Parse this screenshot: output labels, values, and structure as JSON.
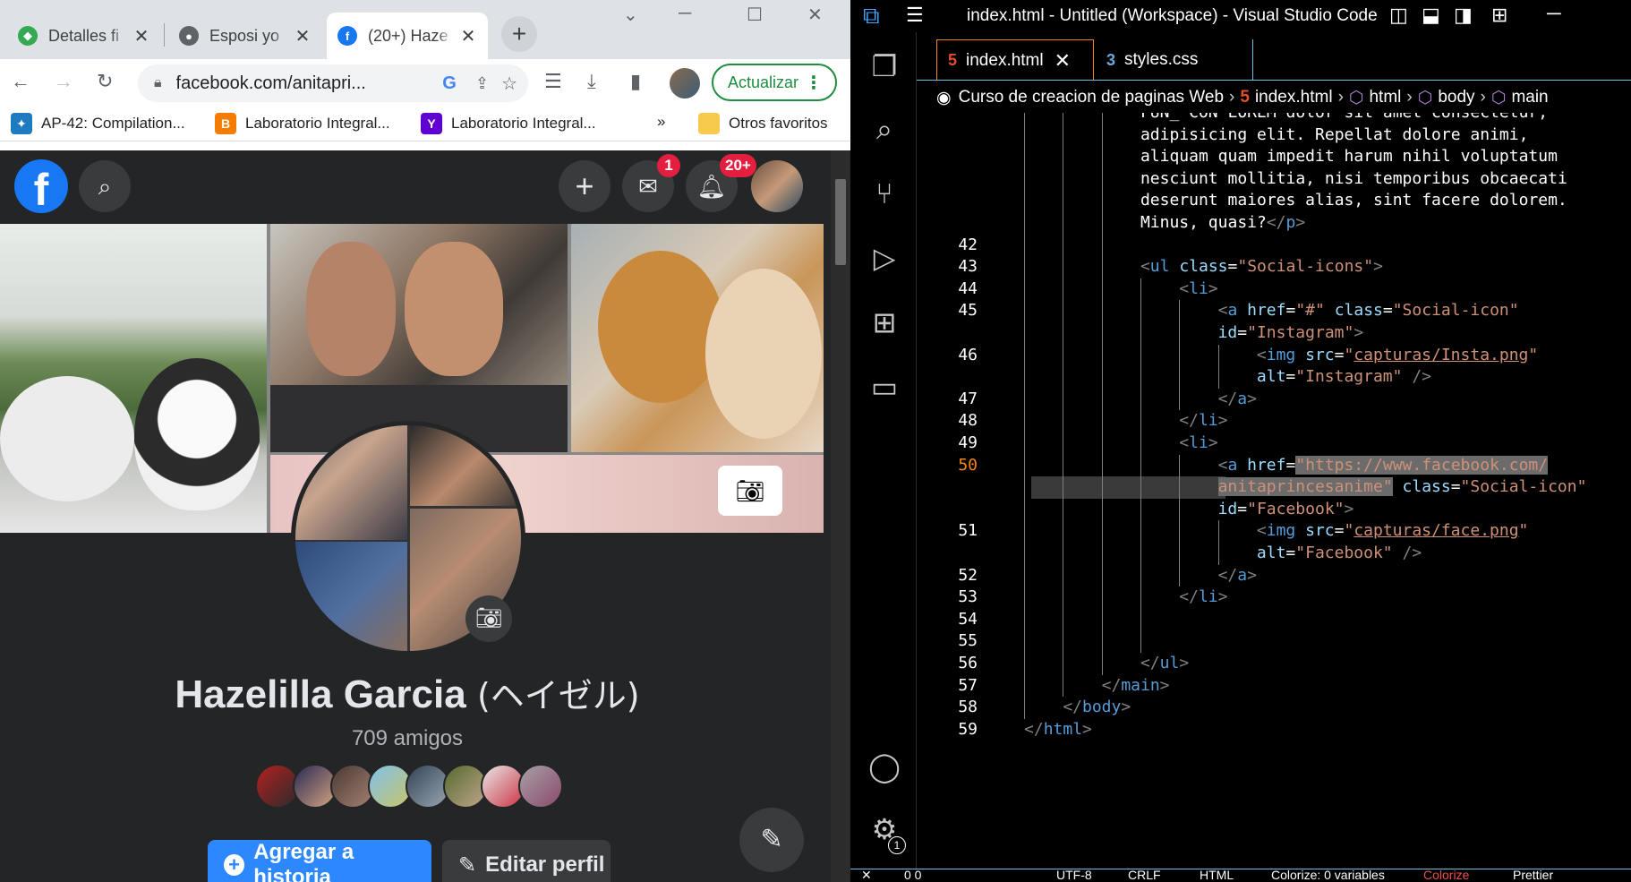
{
  "chrome": {
    "tabs": [
      {
        "title": "Detalles fi",
        "icon": "diamond-icon",
        "color": "#34a853"
      },
      {
        "title": "Esposi yo",
        "icon": "globe-icon",
        "color": "#5f6368"
      },
      {
        "title": "(20+) Haze",
        "icon": "facebook-icon",
        "color": "#1877f2"
      }
    ],
    "url": "facebook.com/anitapri...",
    "update_label": "Actualizar",
    "bookmarks": [
      {
        "label": "AP-42: Compilation...",
        "color": "#1f7bc1"
      },
      {
        "label": "Laboratorio Integral...",
        "color": "#f57c00"
      },
      {
        "label": "Laboratorio Integral...",
        "color": "#6001d2"
      },
      {
        "label": "»",
        "color": ""
      },
      {
        "label": "Otros favoritos",
        "color": "#f7ca4d"
      }
    ]
  },
  "facebook": {
    "messenger_badge": "1",
    "notif_badge": "20+",
    "name": "Hazelilla Garcia",
    "alt_name": "(ヘイゼル)",
    "friends": "709 amigos",
    "story_button": "Agregar a historia",
    "edit_button": "Editar perfil"
  },
  "vscode": {
    "title": "index.html - Untitled (Workspace) - Visual Studio Code",
    "tabs": [
      {
        "label": "index.html",
        "active": true
      },
      {
        "label": "styles.css",
        "active": false
      }
    ],
    "breadcrumbs": [
      "Curso de creacion de paginas Web",
      "index.html",
      "html",
      "body",
      "main"
    ],
    "settings_badge": "1",
    "status": {
      "encoding": "UTF-8",
      "eol": "CRLF",
      "lang": "HTML",
      "colorize": "Colorize: 0 variables",
      "colorize2": "Colorize",
      "prettier": "Prettier",
      "problems": "0  0"
    }
  },
  "code_lines": [
    {
      "num": "",
      "indent": 6,
      "parts": [
        [
          "t-txt",
          "FUN_ CON LOREM dolor sit amet consectetur,"
        ]
      ]
    },
    {
      "num": "",
      "indent": 6,
      "parts": [
        [
          "t-txt",
          "adipisicing elit. Repellat dolore animi,"
        ]
      ]
    },
    {
      "num": "",
      "indent": 6,
      "parts": [
        [
          "t-txt",
          "aliquam quam impedit harum nihil voluptatum"
        ]
      ]
    },
    {
      "num": "",
      "indent": 6,
      "parts": [
        [
          "t-txt",
          "nesciunt mollitia, nisi temporibus obcaecati"
        ]
      ]
    },
    {
      "num": "",
      "indent": 6,
      "parts": [
        [
          "t-txt",
          "deserunt maiores alias, sint facere dolorem."
        ]
      ]
    },
    {
      "num": "",
      "indent": 6,
      "parts": [
        [
          "t-txt",
          "Minus, quasi?"
        ],
        [
          "t-br",
          "</"
        ],
        [
          "t-tag",
          "p"
        ],
        [
          "t-br",
          ">"
        ]
      ]
    },
    {
      "num": "42",
      "indent": 6,
      "parts": []
    },
    {
      "num": "43",
      "indent": 6,
      "parts": [
        [
          "t-br",
          "<"
        ],
        [
          "t-tag",
          "ul"
        ],
        [
          "t-txt",
          " "
        ],
        [
          "t-attr",
          "class"
        ],
        [
          "t-txt",
          "="
        ],
        [
          "t-str",
          "\"Social-icons\""
        ],
        [
          "t-br",
          ">"
        ]
      ]
    },
    {
      "num": "44",
      "indent": 8,
      "parts": [
        [
          "t-br",
          "<"
        ],
        [
          "t-tag",
          "li"
        ],
        [
          "t-br",
          ">"
        ]
      ]
    },
    {
      "num": "45",
      "indent": 10,
      "parts": [
        [
          "t-br",
          "<"
        ],
        [
          "t-tag",
          "a"
        ],
        [
          "t-txt",
          " "
        ],
        [
          "t-attr",
          "href"
        ],
        [
          "t-txt",
          "="
        ],
        [
          "t-str",
          "\"#\""
        ],
        [
          "t-txt",
          " "
        ],
        [
          "t-attr",
          "class"
        ],
        [
          "t-txt",
          "="
        ],
        [
          "t-str",
          "\"Social-icon\""
        ]
      ]
    },
    {
      "num": "",
      "indent": 10,
      "parts": [
        [
          "t-attr",
          "id"
        ],
        [
          "t-txt",
          "="
        ],
        [
          "t-str",
          "\"Instagram\""
        ],
        [
          "t-br",
          ">"
        ]
      ]
    },
    {
      "num": "46",
      "indent": 12,
      "parts": [
        [
          "t-br",
          "<"
        ],
        [
          "t-tag",
          "img"
        ],
        [
          "t-txt",
          " "
        ],
        [
          "t-attr",
          "src"
        ],
        [
          "t-txt",
          "="
        ],
        [
          "t-str",
          "\""
        ],
        [
          "t-str u",
          "capturas/Insta.png"
        ],
        [
          "t-str",
          "\""
        ]
      ]
    },
    {
      "num": "",
      "indent": 12,
      "parts": [
        [
          "t-attr",
          "alt"
        ],
        [
          "t-txt",
          "="
        ],
        [
          "t-str",
          "\"Instagram\""
        ],
        [
          "t-txt",
          " "
        ],
        [
          "t-br",
          "/>"
        ]
      ]
    },
    {
      "num": "47",
      "indent": 10,
      "parts": [
        [
          "t-br",
          "</"
        ],
        [
          "t-tag",
          "a"
        ],
        [
          "t-br",
          ">"
        ]
      ]
    },
    {
      "num": "48",
      "indent": 8,
      "parts": [
        [
          "t-br",
          "</"
        ],
        [
          "t-tag",
          "li"
        ],
        [
          "t-br",
          ">"
        ]
      ]
    },
    {
      "num": "49",
      "indent": 8,
      "parts": [
        [
          "t-br",
          "<"
        ],
        [
          "t-tag",
          "li"
        ],
        [
          "t-br",
          ">"
        ]
      ]
    },
    {
      "num": "50",
      "indent": 10,
      "cur": true,
      "parts": [
        [
          "t-br",
          "<"
        ],
        [
          "t-tag",
          "a"
        ],
        [
          "t-txt",
          " "
        ],
        [
          "t-attr",
          "href"
        ],
        [
          "t-txt",
          "="
        ],
        [
          "t-str sel",
          "\"https://www.facebook.com/"
        ]
      ]
    },
    {
      "num": "",
      "indent": 10,
      "hl": true,
      "parts": [
        [
          "t-str sel",
          "anitaprincesanime\""
        ],
        [
          "t-txt",
          " "
        ],
        [
          "t-attr",
          "class"
        ],
        [
          "t-txt",
          "="
        ],
        [
          "t-str",
          "\"Social-icon\""
        ]
      ]
    },
    {
      "num": "",
      "indent": 10,
      "parts": [
        [
          "t-attr",
          "id"
        ],
        [
          "t-txt",
          "="
        ],
        [
          "t-str",
          "\"Facebook\""
        ],
        [
          "t-br",
          ">"
        ]
      ]
    },
    {
      "num": "51",
      "indent": 12,
      "parts": [
        [
          "t-br",
          "<"
        ],
        [
          "t-tag",
          "img"
        ],
        [
          "t-txt",
          " "
        ],
        [
          "t-attr",
          "src"
        ],
        [
          "t-txt",
          "="
        ],
        [
          "t-str",
          "\""
        ],
        [
          "t-str u",
          "capturas/face.png"
        ],
        [
          "t-str",
          "\""
        ]
      ]
    },
    {
      "num": "",
      "indent": 12,
      "parts": [
        [
          "t-attr",
          "alt"
        ],
        [
          "t-txt",
          "="
        ],
        [
          "t-str",
          "\"Facebook\""
        ],
        [
          "t-txt",
          " "
        ],
        [
          "t-br",
          "/>"
        ]
      ]
    },
    {
      "num": "52",
      "indent": 10,
      "parts": [
        [
          "t-br",
          "</"
        ],
        [
          "t-tag",
          "a"
        ],
        [
          "t-br",
          ">"
        ]
      ]
    },
    {
      "num": "53",
      "indent": 8,
      "parts": [
        [
          "t-br",
          "</"
        ],
        [
          "t-tag",
          "li"
        ],
        [
          "t-br",
          ">"
        ]
      ]
    },
    {
      "num": "54",
      "indent": 8,
      "parts": []
    },
    {
      "num": "55",
      "indent": 8,
      "parts": []
    },
    {
      "num": "56",
      "indent": 6,
      "parts": [
        [
          "t-br",
          "</"
        ],
        [
          "t-tag",
          "ul"
        ],
        [
          "t-br",
          ">"
        ]
      ]
    },
    {
      "num": "57",
      "indent": 4,
      "parts": [
        [
          "t-br",
          "</"
        ],
        [
          "t-tag",
          "main"
        ],
        [
          "t-br",
          ">"
        ]
      ]
    },
    {
      "num": "58",
      "indent": 2,
      "parts": [
        [
          "t-br",
          "</"
        ],
        [
          "t-tag",
          "body"
        ],
        [
          "t-br",
          ">"
        ]
      ]
    },
    {
      "num": "59",
      "indent": 0,
      "parts": [
        [
          "t-br",
          "</"
        ],
        [
          "t-tag",
          "html"
        ],
        [
          "t-br",
          ">"
        ]
      ]
    }
  ]
}
